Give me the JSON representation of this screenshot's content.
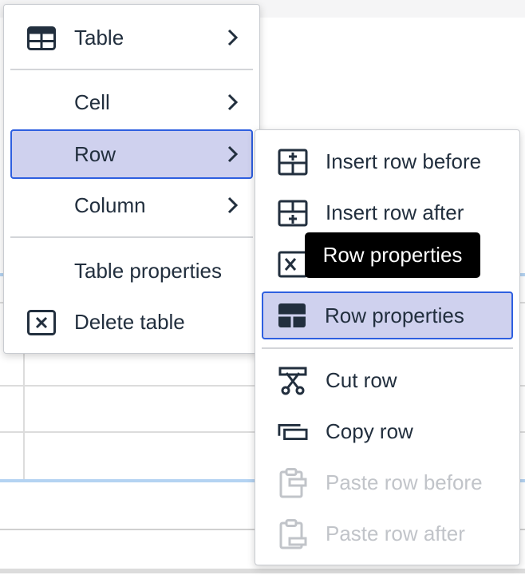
{
  "main_menu": {
    "items": [
      {
        "label": "Table",
        "icon": "table-icon",
        "has_submenu": true
      },
      {
        "label": "Cell",
        "has_submenu": true
      },
      {
        "label": "Row",
        "has_submenu": true,
        "active": true
      },
      {
        "label": "Column",
        "has_submenu": true
      },
      {
        "label": "Table properties"
      },
      {
        "label": "Delete table",
        "icon": "delete-table-icon"
      }
    ]
  },
  "row_submenu": {
    "items": [
      {
        "label": "Insert row before",
        "icon": "insert-row-before-icon"
      },
      {
        "label": "Insert row after",
        "icon": "insert-row-after-icon"
      },
      {
        "label": "Delete row",
        "icon": "delete-row-icon"
      },
      {
        "label": "Row properties",
        "icon": "row-properties-icon",
        "active": true
      },
      {
        "label": "Cut row",
        "icon": "cut-row-icon"
      },
      {
        "label": "Copy row",
        "icon": "copy-row-icon"
      },
      {
        "label": "Paste row before",
        "icon": "paste-row-before-icon",
        "disabled": true
      },
      {
        "label": "Paste row after",
        "icon": "paste-row-after-icon",
        "disabled": true
      }
    ]
  },
  "tooltip": {
    "text": "Row properties"
  },
  "colors": {
    "active_bg": "#cfd1ee",
    "active_border": "#2e5fe0",
    "text": "#222f3e",
    "disabled_text": "#c1c4c9",
    "tooltip_bg": "#000000"
  }
}
